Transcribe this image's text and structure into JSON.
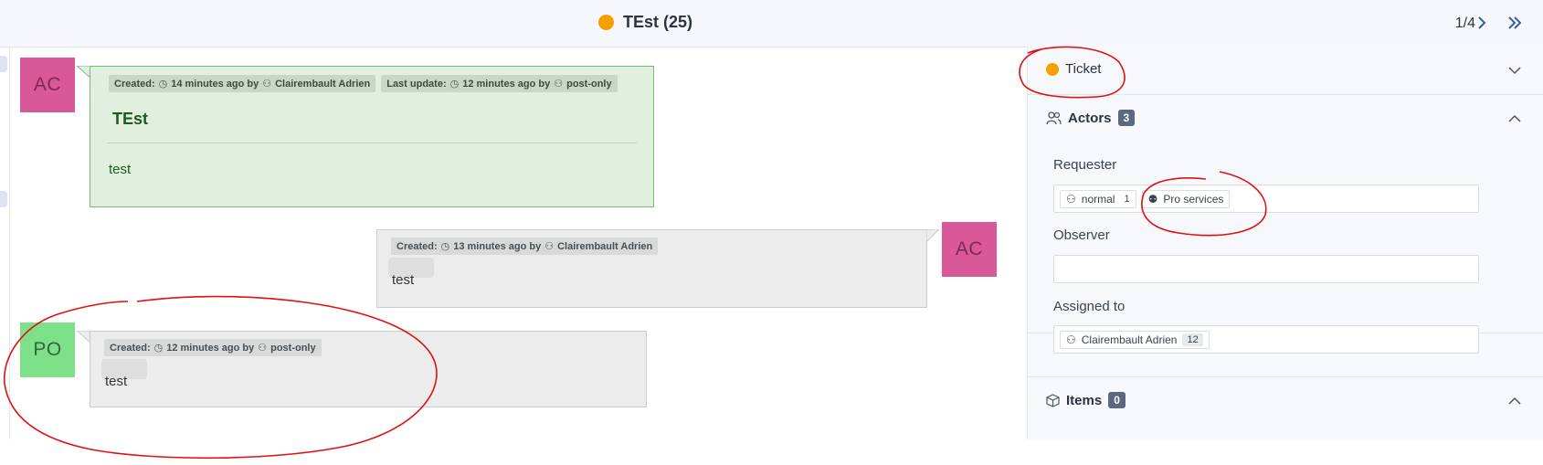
{
  "header": {
    "title": "TEst (25)",
    "status_color": "#f5a000",
    "pager": "1/4",
    "next_icon": "chevron-right-icon",
    "last_icon": "double-chevron-right-icon"
  },
  "timeline": [
    {
      "avatar": "AC",
      "avatar_color": "#d9589a",
      "created_label": "Created:",
      "created_time": "14 minutes ago by",
      "created_user": "Clairembault Adrien",
      "update_label": "Last update:",
      "update_time": "12 minutes ago by",
      "update_user": "post-only",
      "title": "TEst",
      "text": "test"
    },
    {
      "avatar": "AC",
      "avatar_color": "#d9589a",
      "created_label": "Created:",
      "created_time": "13 minutes ago by",
      "created_user": "Clairembault Adrien",
      "text": "test"
    },
    {
      "avatar": "PO",
      "avatar_color": "#7fe08a",
      "created_label": "Created:",
      "created_time": "12 minutes ago by",
      "created_user": "post-only",
      "text": "test"
    }
  ],
  "sidebar": {
    "ticket": {
      "label": "Ticket",
      "status_color": "#f5a000"
    },
    "actors": {
      "label": "Actors",
      "count": "3",
      "requester_label": "Requester",
      "requester_chips": [
        {
          "label": "normal",
          "count": "1",
          "icon": "user-icon"
        },
        {
          "label": "Pro services",
          "icon": "group-icon"
        }
      ],
      "observer_label": "Observer",
      "assigned_label": "Assigned to",
      "assigned_chip": {
        "label": "Clairembault Adrien",
        "count": "12",
        "icon": "user-icon"
      }
    },
    "items": {
      "label": "Items",
      "count": "0"
    }
  },
  "colors": {
    "annotation": "#e01010",
    "followup_bg": "#ececec",
    "ticket_bg": "#e1f0de"
  }
}
